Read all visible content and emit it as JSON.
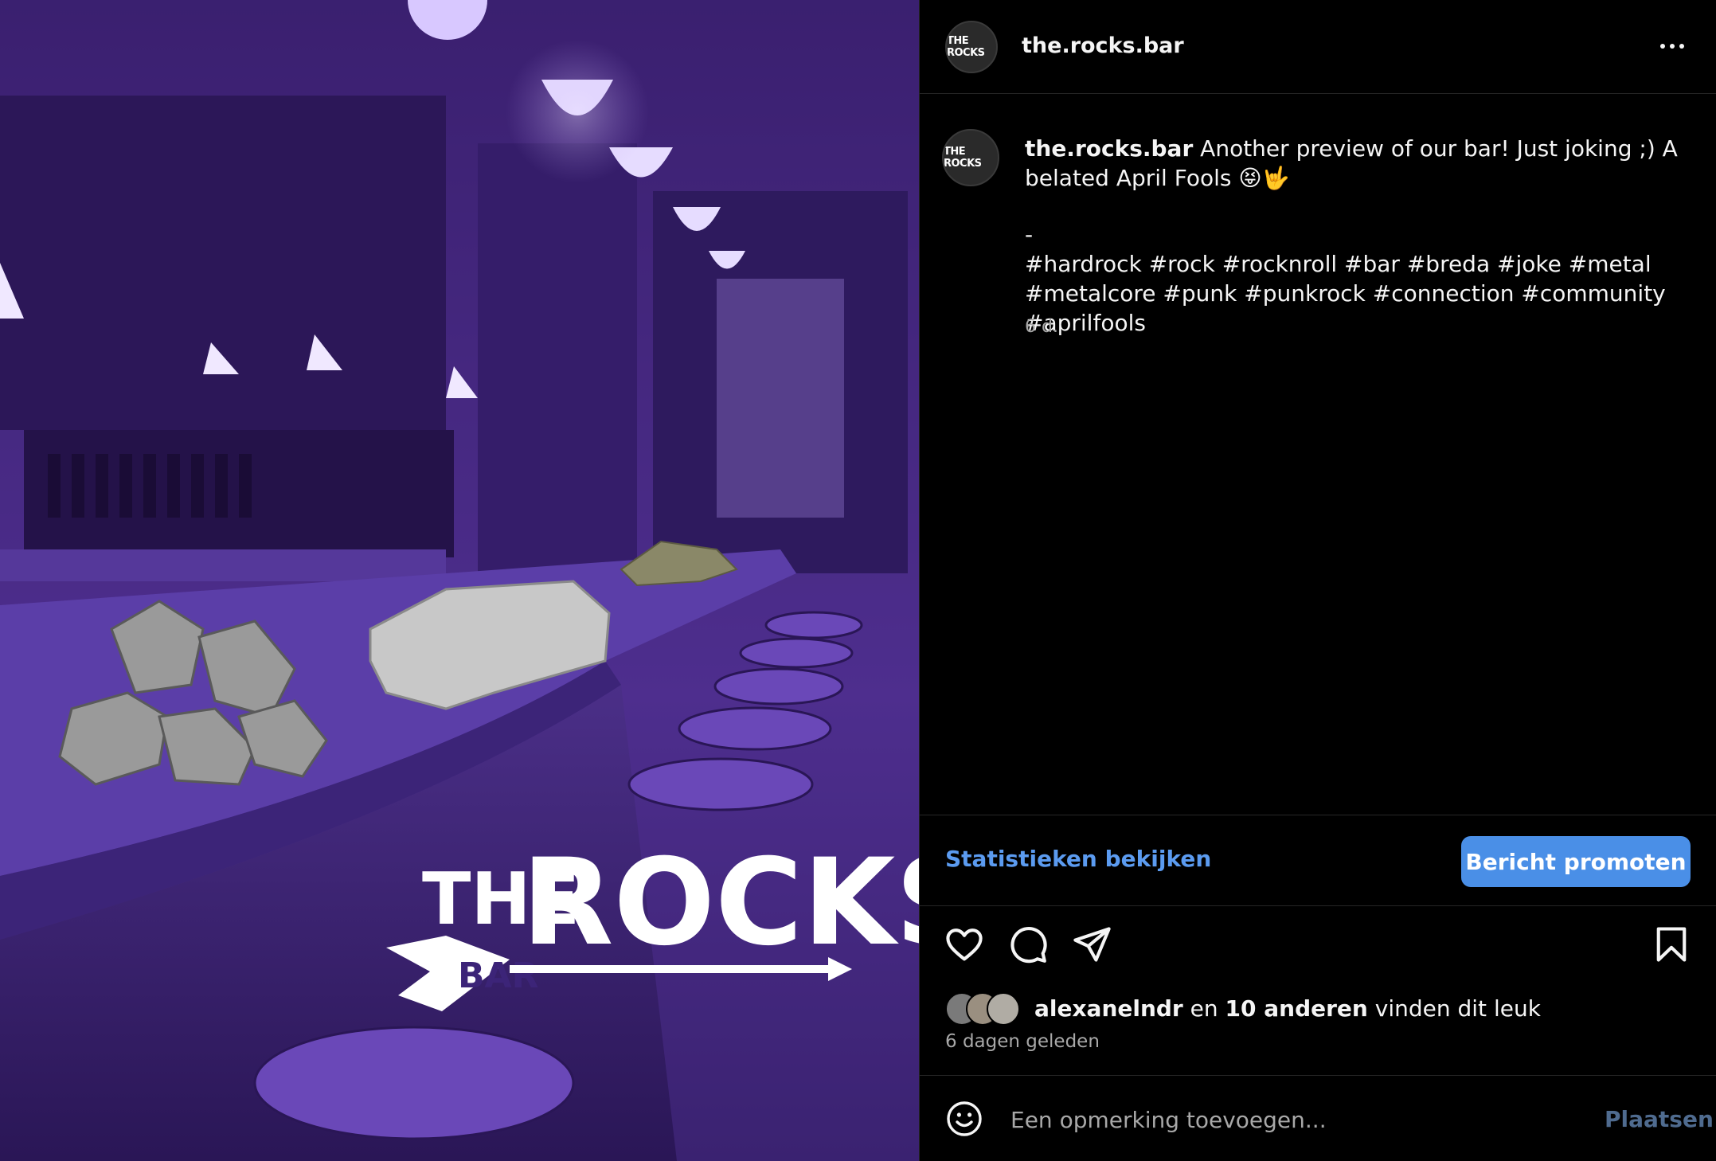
{
  "post": {
    "username": "the.rocks.bar",
    "avatar_text": "THE ROCKS",
    "more_icon": "more-horizontal-icon"
  },
  "caption": {
    "username": "the.rocks.bar",
    "text": "Another preview of our bar! Just joking ;) A belated April Fools 😝🤟",
    "separator": "-",
    "hashtags": "#hardrock #rock #rocknroll #bar #breda #joke #metal #metalcore #punk #punkrock #connection #community #aprilfools",
    "time": "6 d."
  },
  "promo": {
    "stats_label": "Statistieken bekijken",
    "promote_label": "Bericht promoten",
    "promote_color": "#4a8fe7"
  },
  "actions": {
    "like_icon": "heart-icon",
    "comment_icon": "comment-icon",
    "share_icon": "send-icon",
    "save_icon": "bookmark-icon"
  },
  "likes": {
    "user": "alexanelndr",
    "connector": "en",
    "others": "10 anderen",
    "suffix": "vinden dit leuk"
  },
  "timestamp": "6 dagen geleden",
  "comment": {
    "placeholder": "Een opmerking toevoegen...",
    "post_label": "Plaatsen"
  },
  "media": {
    "logo_the": "THE",
    "logo_rocks": "ROCKS",
    "logo_bar": "BAR"
  }
}
